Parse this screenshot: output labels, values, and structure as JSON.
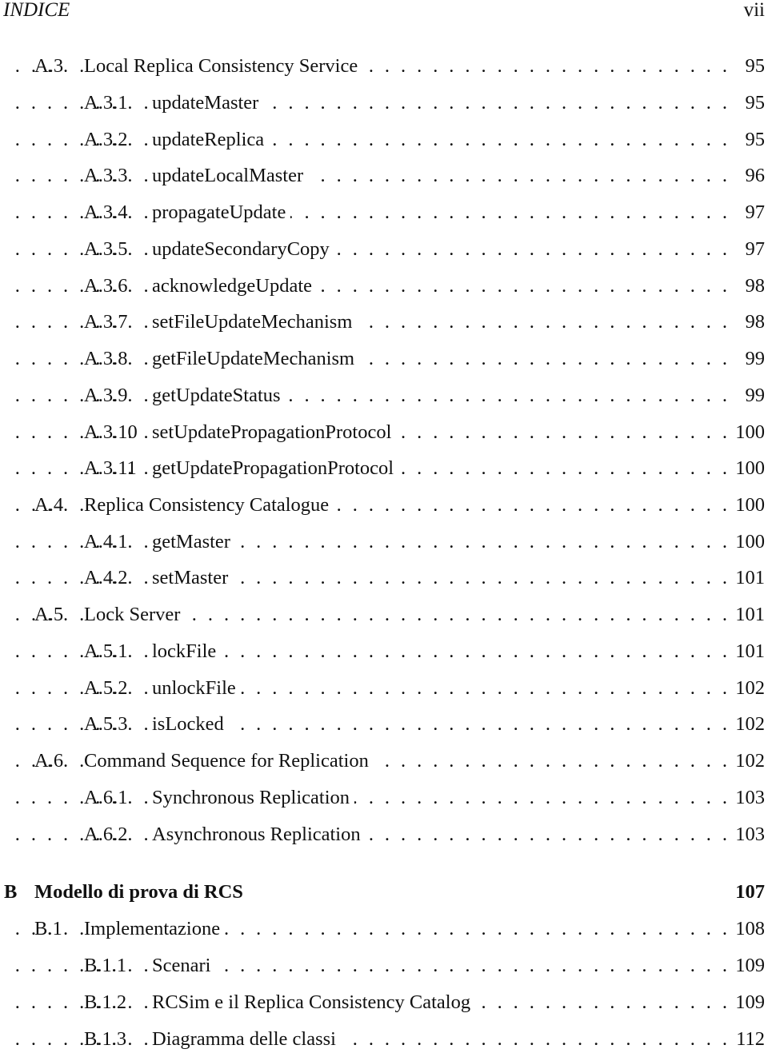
{
  "header": {
    "title": "INDICE",
    "page_number": "vii"
  },
  "toc": [
    {
      "level": "lvl1",
      "num": "A.3",
      "label": "Local Replica Consistency Service",
      "page": "95",
      "leader": true
    },
    {
      "level": "lvl2",
      "num": "A.3.1",
      "label": "updateMaster",
      "page": "95",
      "leader": true
    },
    {
      "level": "lvl2",
      "num": "A.3.2",
      "label": "updateReplica",
      "page": "95",
      "leader": true
    },
    {
      "level": "lvl2",
      "num": "A.3.3",
      "label": "updateLocalMaster",
      "page": "96",
      "leader": true
    },
    {
      "level": "lvl2",
      "num": "A.3.4",
      "label": "propagateUpdate",
      "page": "97",
      "leader": true
    },
    {
      "level": "lvl2",
      "num": "A.3.5",
      "label": "updateSecondaryCopy",
      "page": "97",
      "leader": true
    },
    {
      "level": "lvl2",
      "num": "A.3.6",
      "label": "acknowledgeUpdate",
      "page": "98",
      "leader": true
    },
    {
      "level": "lvl2",
      "num": "A.3.7",
      "label": "setFileUpdateMechanism",
      "page": "98",
      "leader": true
    },
    {
      "level": "lvl2",
      "num": "A.3.8",
      "label": "getFileUpdateMechanism",
      "page": "99",
      "leader": true
    },
    {
      "level": "lvl2",
      "num": "A.3.9",
      "label": "getUpdateStatus",
      "page": "99",
      "leader": true
    },
    {
      "level": "lvl2",
      "num": "A.3.10",
      "label": "setUpdatePropagationProtocol",
      "page": "100",
      "leader": true
    },
    {
      "level": "lvl2",
      "num": "A.3.11",
      "label": "getUpdatePropagationProtocol",
      "page": "100",
      "leader": true
    },
    {
      "level": "lvl1",
      "num": "A.4",
      "label": "Replica Consistency Catalogue",
      "page": "100",
      "leader": true
    },
    {
      "level": "lvl2",
      "num": "A.4.1",
      "label": "getMaster",
      "page": "100",
      "leader": true
    },
    {
      "level": "lvl2",
      "num": "A.4.2",
      "label": "setMaster",
      "page": "101",
      "leader": true
    },
    {
      "level": "lvl1",
      "num": "A.5",
      "label": "Lock Server",
      "page": "101",
      "leader": true
    },
    {
      "level": "lvl2",
      "num": "A.5.1",
      "label": "lockFile",
      "page": "101",
      "leader": true
    },
    {
      "level": "lvl2",
      "num": "A.5.2",
      "label": "unlockFile",
      "page": "102",
      "leader": true
    },
    {
      "level": "lvl2",
      "num": "A.5.3",
      "label": "isLocked",
      "page": "102",
      "leader": true
    },
    {
      "level": "lvl1",
      "num": "A.6",
      "label": "Command Sequence for Replication",
      "page": "102",
      "leader": true
    },
    {
      "level": "lvl2",
      "num": "A.6.1",
      "label": "Synchronous Replication",
      "page": "103",
      "leader": true
    },
    {
      "level": "lvl2",
      "num": "A.6.2",
      "label": "Asynchronous Replication",
      "page": "103",
      "leader": true
    },
    {
      "level": "chap",
      "num": "B",
      "label": "Modello di prova di RCS",
      "page": "107",
      "leader": false
    },
    {
      "level": "lvl1",
      "num": "B.1",
      "label": "Implementazione",
      "page": "108",
      "leader": true
    },
    {
      "level": "lvl2",
      "num": "B.1.1",
      "label": "Scenari",
      "page": "109",
      "leader": true
    },
    {
      "level": "lvl2",
      "num": "B.1.2",
      "label": "RCSim e il Replica Consistency Catalog",
      "page": "109",
      "leader": true
    },
    {
      "level": "lvl2",
      "num": "B.1.3",
      "label": "Diagramma delle classi",
      "page": "112",
      "leader": true
    }
  ]
}
